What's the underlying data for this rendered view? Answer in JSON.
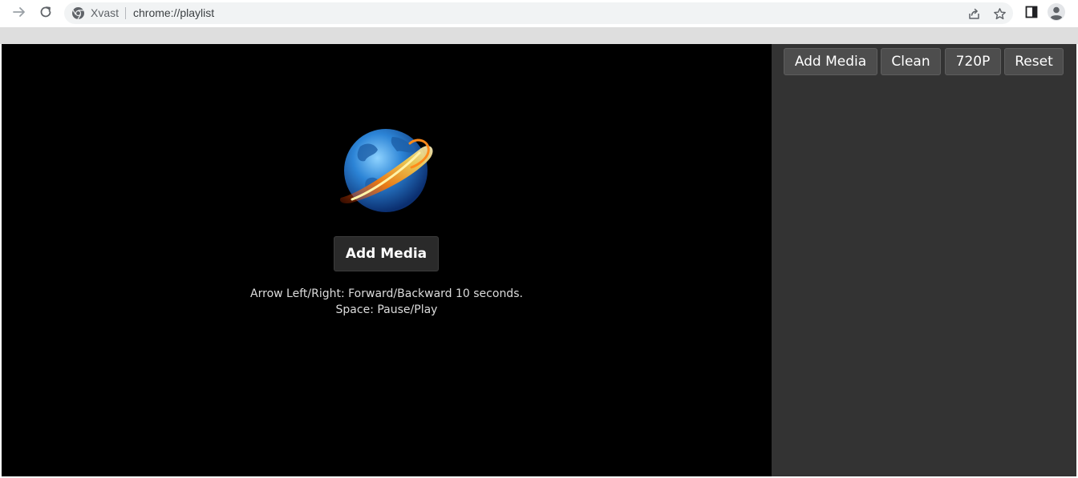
{
  "browser": {
    "site_name": "Xvast",
    "url": "chrome://playlist",
    "icons": {
      "back": "arrow-right-icon",
      "reload": "reload-icon",
      "site": "chrome-icon",
      "share": "share-icon",
      "bookmark": "star-icon",
      "side_panel": "side-panel-icon",
      "profile": "avatar-icon"
    }
  },
  "player": {
    "logo": "xvast-globe-logo",
    "add_media_label": "Add Media",
    "hint_line1": "Arrow Left/Right: Forward/Backward 10 seconds.",
    "hint_line2": "Space: Pause/Play"
  },
  "sidebar": {
    "buttons": [
      {
        "label": "Add Media"
      },
      {
        "label": "Clean"
      },
      {
        "label": "720P"
      },
      {
        "label": "Reset"
      }
    ]
  },
  "colors": {
    "player_bg": "#000000",
    "sidebar_bg": "#333333",
    "button_bg": "#4d4d4d"
  }
}
